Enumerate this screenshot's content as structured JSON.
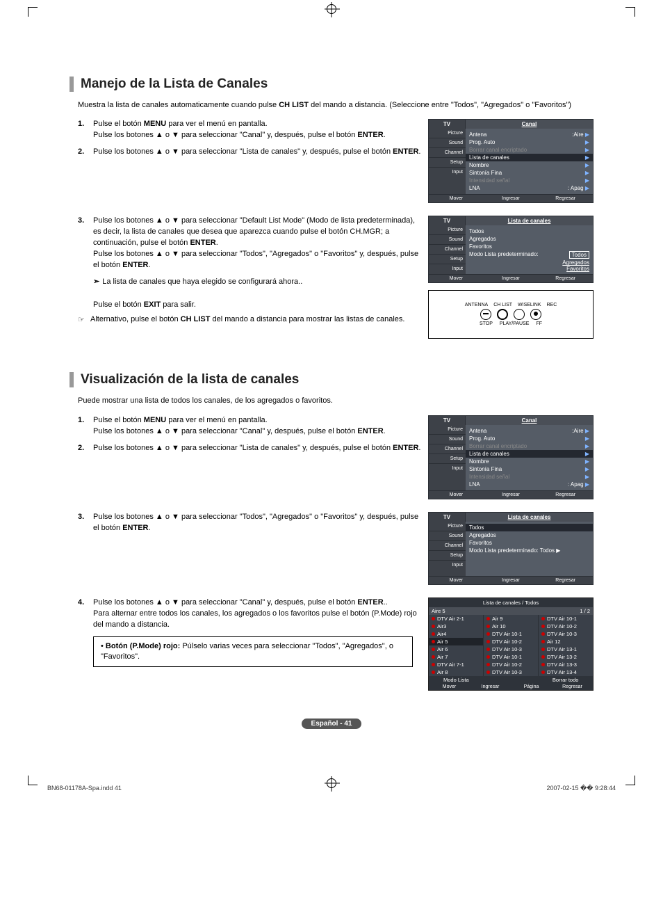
{
  "section1": {
    "title": "Manejo de la Lista de Canales",
    "intro_a": "Muestra la lista de canales automaticamente cuando pulse ",
    "intro_b": "CH LIST",
    "intro_c": " del mando a distancia. (Seleccione entre \"Todos\", \"Agregados\" o \"Favoritos\")",
    "step1_a": "Pulse el botón ",
    "step1_b": "MENU",
    "step1_c": " para ver el menú en pantalla.",
    "step1_d": "Pulse los botones ▲ o ▼ para seleccionar \"Canal\" y, después, pulse el botón ",
    "step1_e": "ENTER",
    "step1_f": ".",
    "step2_a": "Pulse los botones ▲ o ▼ para seleccionar \"Lista de canales\" y, después, pulse el botón ",
    "step2_b": "ENTER",
    "step2_c": ".",
    "step3_a": "Pulse los botones ▲ o ▼ para seleccionar \"Default List Mode\" (Modo de lista predeterminada), es decir, la lista de canales que desea que aparezca cuando pulse el botón CH.MGR; a continuación, pulse el botón ",
    "step3_b": "ENTER",
    "step3_c": ".",
    "step3_d": "Pulse los botones ▲ o ▼ para seleccionar \"Todos\", \"Agregados\" o \"Favoritos\" y, después, pulse el botón ",
    "step3_e": "ENTER",
    "step3_f": ".",
    "note": "La lista de canales que haya elegido se configurará ahora..",
    "exit_a": "Pulse el botón ",
    "exit_b": "EXIT",
    "exit_c": " para salir.",
    "alt_a": "Alternativo, pulse el botón ",
    "alt_b": "CH LIST",
    "alt_c": " del mando a distancia para mostrar las listas de canales."
  },
  "section2": {
    "title": "Visualización de la lista de canales",
    "intro": "Puede mostrar una lista de todos los canales, de los agregados o favoritos.",
    "step1_a": "Pulse el botón ",
    "step1_b": "MENU",
    "step1_c": " para ver el menú en pantalla.",
    "step1_d": "Pulse los botones ▲ o ▼ para seleccionar \"Canal\" y, después, pulse el botón ",
    "step1_e": "ENTER",
    "step1_f": ".",
    "step2_a": "Pulse los botones ▲ o ▼ para seleccionar \"Lista de canales\" y, después, pulse el botón ",
    "step2_b": "ENTER",
    "step2_c": ".",
    "step3_a": "Pulse los botones ▲ o ▼ para seleccionar \"Todos\", \"Agregados\" o \"Favoritos\" y, después, pulse el botón ",
    "step3_b": "ENTER",
    "step3_c": ".",
    "step4_a": "Pulse los botones ▲ o ▼ para seleccionar \"Canal\" y, después, pulse el botón ",
    "step4_b": "ENTER",
    "step4_c": "..",
    "step4_d": "Para alternar entre todos los canales, los agregados o los favoritos pulse el botón (P.Mode) rojo del mando a distancia.",
    "redbox_a": "Botón (P.Mode) rojo:",
    "redbox_b": " Púlselo varias veces para seleccionar \"Todos\", \"Agregados\", o \"Favoritos\"."
  },
  "osd_canal": {
    "tv": "TV",
    "title": "Canal",
    "side": [
      "Picture",
      "Sound",
      "Channel",
      "Setup",
      "Input"
    ],
    "rows": [
      {
        "l": "Antena",
        "r": ":Aire",
        "sel": false,
        "dim": false
      },
      {
        "l": "Prog. Auto",
        "r": "",
        "sel": false,
        "dim": false
      },
      {
        "l": "Borrar canal encriptado",
        "r": "",
        "sel": false,
        "dim": true
      },
      {
        "l": "Lista de canales",
        "r": "",
        "sel": true,
        "dim": false
      },
      {
        "l": "Nombre",
        "r": "",
        "sel": false,
        "dim": false
      },
      {
        "l": "Sintonía Fina",
        "r": "",
        "sel": false,
        "dim": false
      },
      {
        "l": "Intensidad señal",
        "r": "",
        "sel": false,
        "dim": true
      },
      {
        "l": "LNA",
        "r": ": Apag",
        "sel": false,
        "dim": false
      }
    ],
    "foot": [
      "Mover",
      "Ingresar",
      "Regresar"
    ]
  },
  "osd_lista1": {
    "tv": "TV",
    "title": "Lista de canales",
    "side": [
      "Picture",
      "Sound",
      "Channel",
      "Setup",
      "Input"
    ],
    "items": [
      "Todos",
      "Agregados",
      "Favoritos"
    ],
    "modo": "Modo Lista predeterminado:",
    "sel": "Todos",
    "drop": [
      "Agregados",
      "Favoritos"
    ],
    "foot": [
      "Mover",
      "Ingresar",
      "Regresar"
    ]
  },
  "osd_lista2": {
    "tv": "TV",
    "title": "Lista de canales",
    "side": [
      "Picture",
      "Sound",
      "Channel",
      "Setup",
      "Input"
    ],
    "items": [
      "Todos",
      "Agregados",
      "Favoritos"
    ],
    "modo": "Modo Lista predeterminado: Todos ▶",
    "foot": [
      "Mover",
      "Ingresar",
      "Regresar"
    ]
  },
  "remote": {
    "top": [
      "ANTENNA",
      "CH LIST",
      "WISELINK",
      "REC"
    ],
    "bot": [
      "STOP",
      "PLAY/PAUSE",
      "FF"
    ]
  },
  "chlist": {
    "title": "Lista de canales / Todos",
    "sub_l": "Aire 5",
    "sub_r": "1 / 2",
    "col1": [
      "DTV Air 2-1",
      "Air3",
      "Air4",
      "Air 5",
      "Air 6",
      "Air 7",
      "DTV Air 7-1",
      "Air 8"
    ],
    "col2": [
      "Air 9",
      "Air 10",
      "DTV Air 10-1",
      "DTV Air 10-2",
      "DTV Air 10-3",
      "DTV Air 10-1",
      "DTV Air 10-2",
      "DTV Air 10-3"
    ],
    "col3": [
      "DTV Air 10-1",
      "DTV Air 10-2",
      "DTV Air 10-3",
      "Air 12",
      "DTV Air 13-1",
      "DTV Air 13-2",
      "DTV Air 13-3",
      "DTV Air 13-4"
    ],
    "mid": [
      "Modo Lista",
      "",
      "Borrar todo"
    ],
    "foot": [
      "Mover",
      "Ingresar",
      "Página",
      "Regresar"
    ]
  },
  "page": "Español - 41",
  "footer_l": "BN68-01178A-Spa.indd   41",
  "footer_r": "2007-02-15   �� 9:28:44"
}
